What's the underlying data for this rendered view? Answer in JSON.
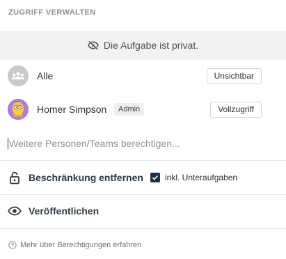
{
  "header": {
    "title": "ZUGRIFF VERWALTEN"
  },
  "banner": {
    "icon": "eye-off-icon",
    "text": "Die Aufgabe ist privat."
  },
  "members": [
    {
      "name": "Alle",
      "avatar": "group-icon",
      "badge": "",
      "access": "Unsichtbar"
    },
    {
      "name": "Homer Simpson",
      "avatar": "homer-avatar",
      "badge": "Admin",
      "access": "Vollzugriff"
    }
  ],
  "invite": {
    "placeholder": "Weitere Personen/Teams berechtigen..."
  },
  "restriction": {
    "icon": "lock-open-icon",
    "label": "Beschränkung entfernen",
    "include_subtasks_label": "inkl. Unteraufgaben",
    "include_subtasks_checked": true
  },
  "publish": {
    "icon": "eye-icon",
    "label": "Veröffentlichen"
  },
  "footer": {
    "icon": "help-circle-icon",
    "link": "Mehr über Berechtigungen erfahren"
  },
  "colors": {
    "banner_bg": "#f2f2f2",
    "checkbox": "#1f3247",
    "muted": "#8a8f94"
  }
}
